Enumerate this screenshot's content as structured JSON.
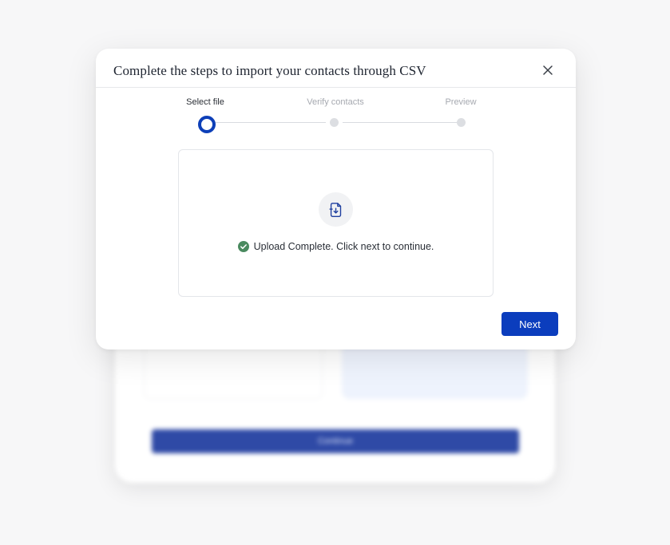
{
  "background": {
    "continue_label": "Continue"
  },
  "modal": {
    "title": "Complete the steps to import your contacts through CSV",
    "close_icon": "close-icon"
  },
  "stepper": {
    "steps": [
      {
        "label": "Select file",
        "state": "active"
      },
      {
        "label": "Verify contacts",
        "state": "inactive"
      },
      {
        "label": "Preview",
        "state": "inactive"
      }
    ],
    "active_color": "#0d3fb8"
  },
  "upload": {
    "icon": "file-import-icon",
    "status_icon": "check-circle-icon",
    "status_text": "Upload Complete. Click next to continue.",
    "success_color": "#4a8a5f"
  },
  "actions": {
    "next_label": "Next",
    "primary_color": "#0b3dbd"
  }
}
